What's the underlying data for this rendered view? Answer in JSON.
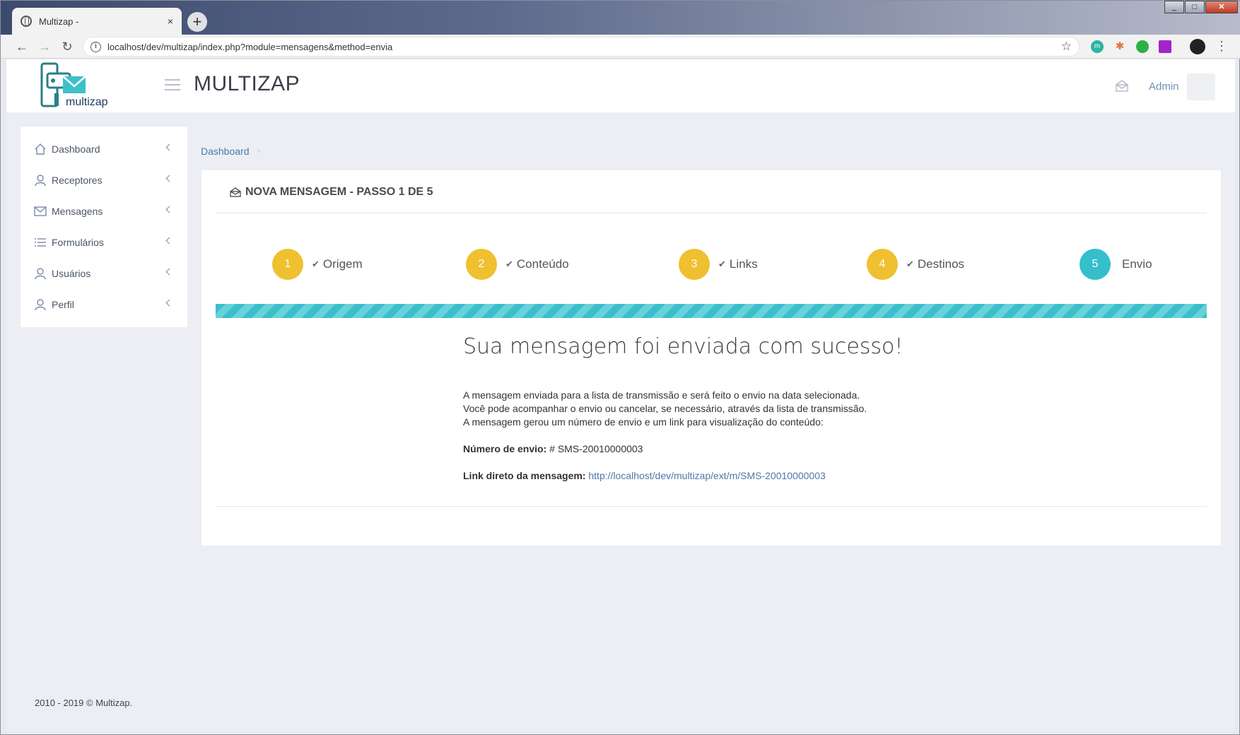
{
  "browser": {
    "tab_title": "Multizap -",
    "tab_close": "×",
    "new_tab": "+",
    "url": "localhost/dev/multizap/index.php?module=mensagens&method=envia",
    "window_controls": [
      "_",
      "□",
      "✕"
    ]
  },
  "header": {
    "logo_text": "multizap",
    "brand": "MULTIZAP",
    "user": "Admin"
  },
  "sidebar": {
    "items": [
      {
        "label": "Dashboard",
        "icon": "home-icon"
      },
      {
        "label": "Receptores",
        "icon": "users-icon"
      },
      {
        "label": "Mensagens",
        "icon": "envelope-icon"
      },
      {
        "label": "Formulários",
        "icon": "list-icon"
      },
      {
        "label": "Usuários",
        "icon": "user-icon"
      },
      {
        "label": "Perfil",
        "icon": "user-icon"
      }
    ]
  },
  "breadcrumb": {
    "item": "Dashboard",
    "sep": "›"
  },
  "card": {
    "title": "NOVA MENSAGEM - PASSO 1 DE 5",
    "steps": [
      {
        "num": "1",
        "label": "Origem",
        "done": true
      },
      {
        "num": "2",
        "label": "Conteúdo",
        "done": true
      },
      {
        "num": "3",
        "label": "Links",
        "done": true
      },
      {
        "num": "4",
        "label": "Destinos",
        "done": true
      },
      {
        "num": "5",
        "label": "Envio",
        "done": false
      }
    ],
    "progress": 1.0,
    "success_title": "Sua mensagem foi enviada com sucesso!",
    "lines": [
      "A mensagem enviada para a lista de transmissão e será feito o envio na data selecionada.",
      "Você pode acompanhar o envio ou cancelar, se necessário, através da lista de transmissão.",
      "A mensagem gerou um número de envio e um link para visualização do conteúdo:"
    ],
    "numero_label": "Número de envio:",
    "numero_value": "# SMS-20010000003",
    "link_label": "Link direto da mensagem:",
    "link_value": "http://localhost/dev/multizap/ext/m/SMS-20010000003"
  },
  "footer": "2010 - 2019 © Multizap.",
  "colors": {
    "step_done": "#efc02f",
    "step_active": "#34bfcb",
    "progress": "#3cbfcb",
    "link": "#4d79a8"
  }
}
